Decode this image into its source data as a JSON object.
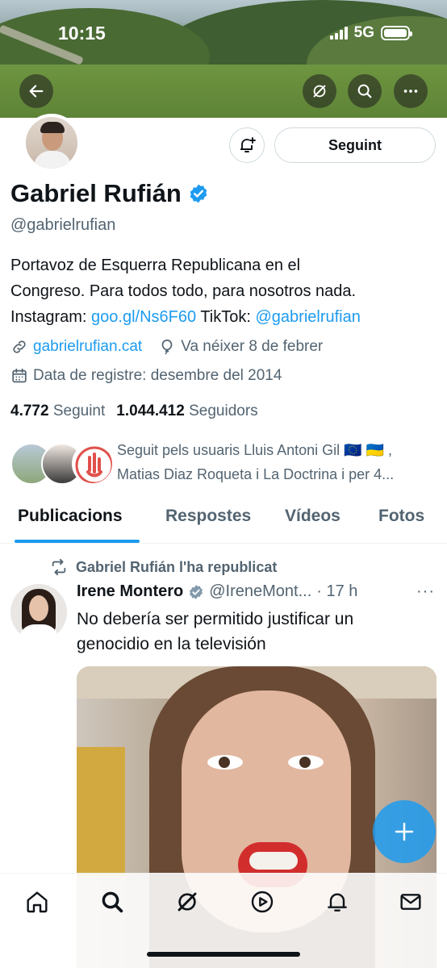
{
  "status_bar": {
    "time": "10:15",
    "network": "5G"
  },
  "profile": {
    "name": "Gabriel Rufián",
    "handle": "@gabrielrufian",
    "follow_button": "Seguint",
    "bio": {
      "line1": "Portavoz de Esquerra Republicana en el",
      "line2": "Congreso. Para todos todo, para nosotros nada.",
      "line3_prefix": "Instagram: ",
      "instagram_link": "goo.gl/Ns6F60",
      "line3_mid": " TikTok: ",
      "tiktok_link": "@gabrielrufian"
    },
    "website": "gabrielrufian.cat",
    "birthday": "Va néixer 8 de febrer",
    "joined": "Data de registre: desembre del 2014",
    "following_count": "4.772",
    "following_label": "Seguint",
    "followers_count": "1.044.412",
    "followers_label": "Seguidors",
    "followed_by_line1": "Seguit pels usuaris Lluis Antoni Gil 🇪🇺 🇺🇦 ,",
    "followed_by_line2": "Matias Diaz Roqueta i La Doctrina i per 4..."
  },
  "tabs": [
    "Publicacions",
    "Respostes",
    "Vídeos",
    "Fotos"
  ],
  "tweet": {
    "repost_text": "Gabriel Rufián l'ha republicat",
    "author_name": "Irene Montero",
    "author_handle": "@IreneMont...",
    "time": "· 17 h",
    "text_line1": "No debería ser permitido justificar un",
    "text_line2": "genocidio en la televisión"
  },
  "colors": {
    "accent": "#1d9bf0",
    "muted": "#536471",
    "text": "#0f1419"
  }
}
